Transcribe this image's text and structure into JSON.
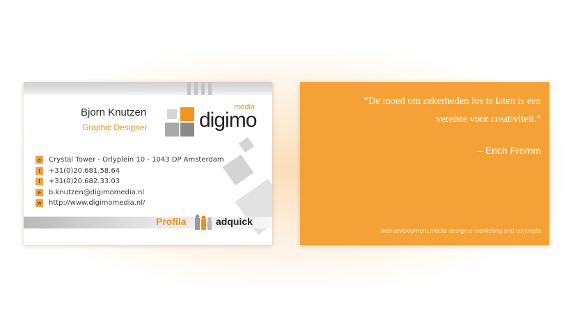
{
  "front": {
    "name": "Bjorn Knutzen",
    "role": "Graphic Designer",
    "logo": {
      "text": "digimo",
      "superscript": "media"
    },
    "contacts": [
      {
        "letter": "a",
        "text": "Crystal Tower - Orlyplein 10 - 1043 DP Amsterdam"
      },
      {
        "letter": "t",
        "text": "+31(0)20.681.58.64"
      },
      {
        "letter": "f",
        "text": "+31(0)20.682.33.03"
      },
      {
        "letter": "e",
        "text": "b.knutzen@digimomedia.nl"
      },
      {
        "letter": "w",
        "text": "http://www.digimomedia.nl/"
      }
    ],
    "partners": {
      "first": "Profila",
      "second": "adquick"
    }
  },
  "back": {
    "quote_line1": "“De moed om zekerheden los te laten is een",
    "quote_line2": "vereiste voor creativiteit.”",
    "author": "– Erich Fromm",
    "tagline": "webdevelopment.media design.e-marketing and concepts"
  },
  "colors": {
    "accent": "#f0911c",
    "card_back": "#f4a237",
    "gray": "#c3c3c3"
  },
  "icons": [
    "logo-squares-icon",
    "partner-figures-icon"
  ]
}
